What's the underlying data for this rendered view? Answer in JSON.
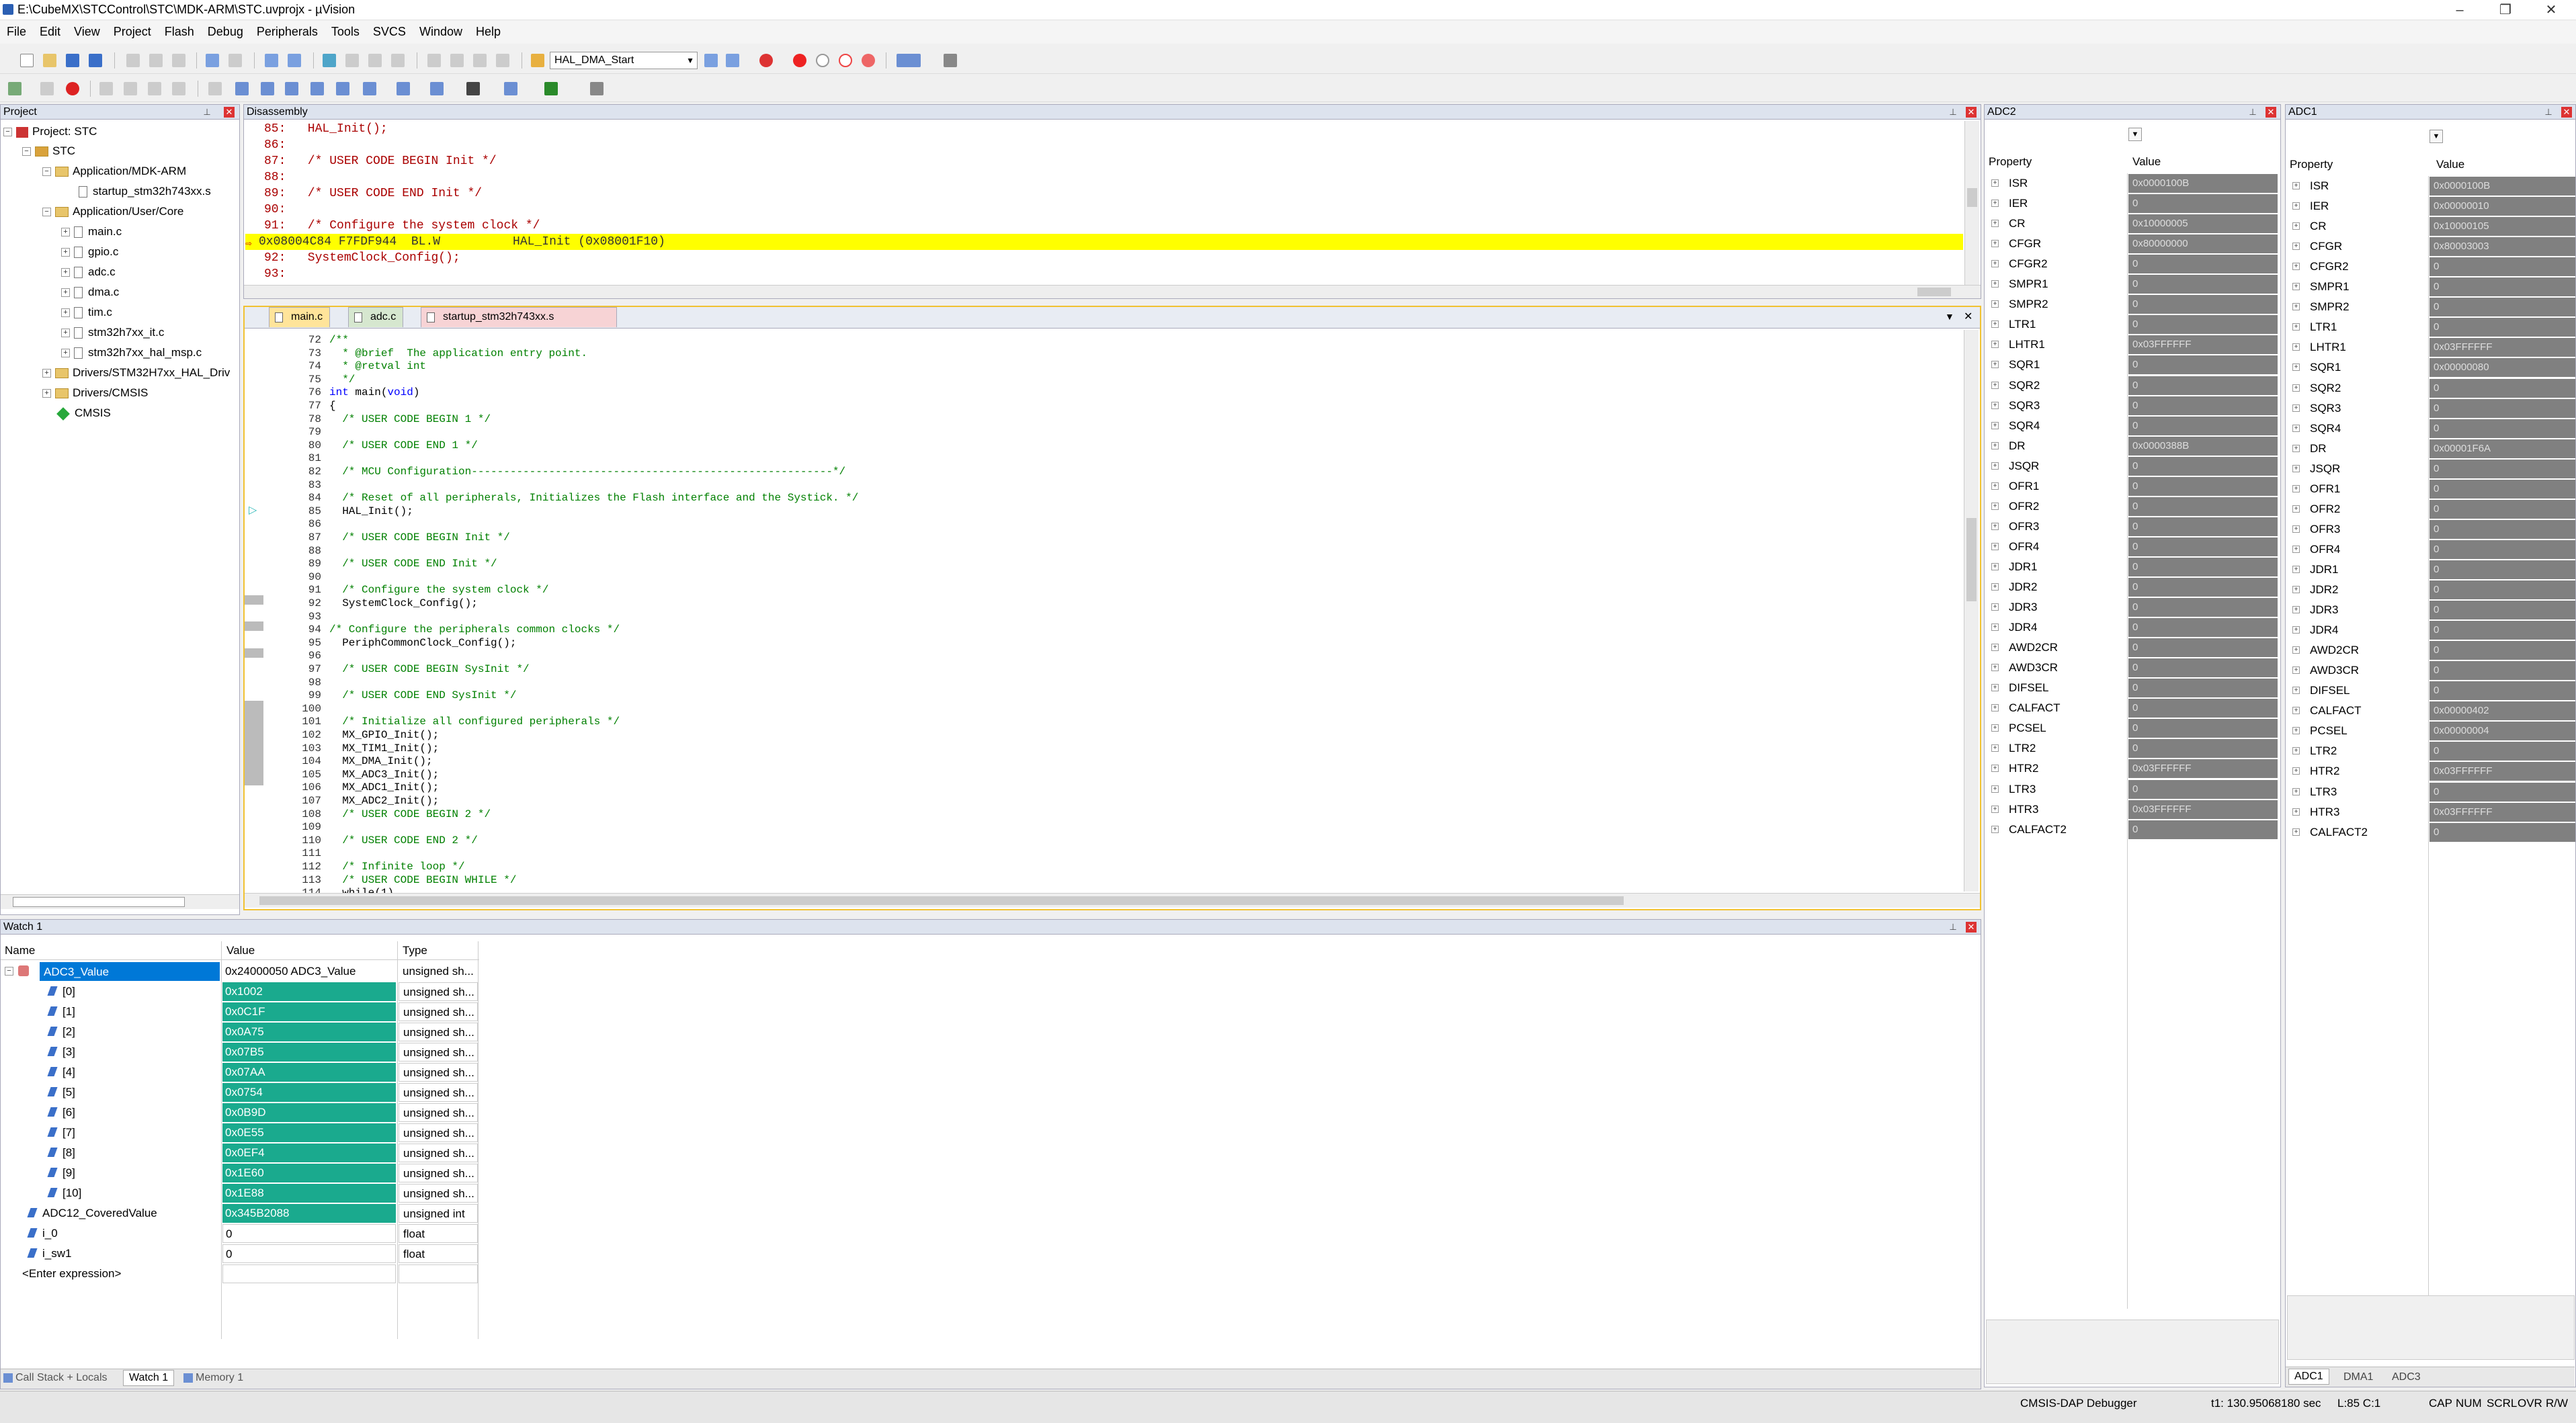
{
  "window": {
    "title": "E:\\CubeMX\\STCControl\\STC\\MDK-ARM\\STC.uvprojx - µVision"
  },
  "menu": [
    "File",
    "Edit",
    "View",
    "Project",
    "Flash",
    "Debug",
    "Peripherals",
    "Tools",
    "SVCS",
    "Window",
    "Help"
  ],
  "toolbar": {
    "target_combo": "HAL_DMA_Start"
  },
  "project": {
    "title": "Project",
    "root": "Project: STC",
    "target": "STC",
    "groups": [
      {
        "name": "Application/MDK-ARM",
        "files": [
          "startup_stm32h743xx.s"
        ]
      },
      {
        "name": "Application/User/Core",
        "files": [
          "main.c",
          "gpio.c",
          "adc.c",
          "dma.c",
          "tim.c",
          "stm32h7xx_it.c",
          "stm32h7xx_hal_msp.c"
        ]
      },
      {
        "name": "Drivers/STM32H7xx_HAL_Driv",
        "files": []
      },
      {
        "name": "Drivers/CMSIS",
        "files": []
      }
    ],
    "cmsis": "CMSIS"
  },
  "disassembly": {
    "title": "Disassembly",
    "lines": [
      "85:   HAL_Init();",
      "86: ",
      "87:   /* USER CODE BEGIN Init */",
      "88: ",
      "89:   /* USER CODE END Init */",
      "90: ",
      "91:   /* Configure the system clock */"
    ],
    "highlight": "0x08004C84 F7FDF944  BL.W          HAL_Init (0x08001F10)",
    "after": [
      "92:   SystemClock_Config();",
      "93: "
    ]
  },
  "editor": {
    "tabs": [
      "main.c",
      "adc.c",
      "startup_stm32h743xx.s"
    ],
    "lines": [
      {
        "n": "72",
        "t": "/**",
        "c": "cm"
      },
      {
        "n": "73",
        "t": "  * @brief  The application entry point.",
        "c": "cm"
      },
      {
        "n": "74",
        "t": "  * @retval int",
        "c": "cm"
      },
      {
        "n": "75",
        "t": "  */",
        "c": "cm"
      },
      {
        "n": "76",
        "t": "int main(void)",
        "c": ""
      },
      {
        "n": "77",
        "t": "{",
        "c": ""
      },
      {
        "n": "78",
        "t": "  /* USER CODE BEGIN 1 */",
        "c": "cm"
      },
      {
        "n": "79",
        "t": "",
        "c": ""
      },
      {
        "n": "80",
        "t": "  /* USER CODE END 1 */",
        "c": "cm"
      },
      {
        "n": "81",
        "t": "",
        "c": ""
      },
      {
        "n": "82",
        "t": "  /* MCU Configuration--------------------------------------------------------*/",
        "c": "cm"
      },
      {
        "n": "83",
        "t": "",
        "c": ""
      },
      {
        "n": "84",
        "t": "  /* Reset of all peripherals, Initializes the Flash interface and the Systick. */",
        "c": "cm"
      },
      {
        "n": "85",
        "t": "  HAL_Init();",
        "c": ""
      },
      {
        "n": "86",
        "t": "",
        "c": ""
      },
      {
        "n": "87",
        "t": "  /* USER CODE BEGIN Init */",
        "c": "cm"
      },
      {
        "n": "88",
        "t": "",
        "c": ""
      },
      {
        "n": "89",
        "t": "  /* USER CODE END Init */",
        "c": "cm"
      },
      {
        "n": "90",
        "t": "",
        "c": ""
      },
      {
        "n": "91",
        "t": "  /* Configure the system clock */",
        "c": "cm"
      },
      {
        "n": "92",
        "t": "  SystemClock_Config();",
        "c": ""
      },
      {
        "n": "93",
        "t": "",
        "c": ""
      },
      {
        "n": "94",
        "t": "/* Configure the peripherals common clocks */",
        "c": "cm"
      },
      {
        "n": "95",
        "t": "  PeriphCommonClock_Config();",
        "c": ""
      },
      {
        "n": "96",
        "t": "",
        "c": ""
      },
      {
        "n": "97",
        "t": "  /* USER CODE BEGIN SysInit */",
        "c": "cm"
      },
      {
        "n": "98",
        "t": "",
        "c": ""
      },
      {
        "n": "99",
        "t": "  /* USER CODE END SysInit */",
        "c": "cm"
      },
      {
        "n": "100",
        "t": "",
        "c": ""
      },
      {
        "n": "101",
        "t": "  /* Initialize all configured peripherals */",
        "c": "cm"
      },
      {
        "n": "102",
        "t": "  MX_GPIO_Init();",
        "c": ""
      },
      {
        "n": "103",
        "t": "  MX_TIM1_Init();",
        "c": ""
      },
      {
        "n": "104",
        "t": "  MX_DMA_Init();",
        "c": ""
      },
      {
        "n": "105",
        "t": "  MX_ADC3_Init();",
        "c": ""
      },
      {
        "n": "106",
        "t": "  MX_ADC1_Init();",
        "c": ""
      },
      {
        "n": "107",
        "t": "  MX_ADC2_Init();",
        "c": ""
      },
      {
        "n": "108",
        "t": "  /* USER CODE BEGIN 2 */",
        "c": "cm"
      },
      {
        "n": "109",
        "t": "",
        "c": ""
      },
      {
        "n": "110",
        "t": "  /* USER CODE END 2 */",
        "c": "cm"
      },
      {
        "n": "111",
        "t": "",
        "c": ""
      },
      {
        "n": "112",
        "t": "  /* Infinite loop */",
        "c": "cm"
      },
      {
        "n": "113",
        "t": "  /* USER CODE BEGIN WHILE */",
        "c": "cm"
      },
      {
        "n": "114",
        "t": "  while(1)",
        "c": ""
      }
    ]
  },
  "adc2": {
    "title": "ADC2",
    "col_property": "Property",
    "col_value": "Value",
    "rows": [
      [
        "ISR",
        "0x0000100B"
      ],
      [
        "IER",
        "0"
      ],
      [
        "CR",
        "0x10000005"
      ],
      [
        "CFGR",
        "0x80000000"
      ],
      [
        "CFGR2",
        "0"
      ],
      [
        "SMPR1",
        "0"
      ],
      [
        "SMPR2",
        "0"
      ],
      [
        "LTR1",
        "0"
      ],
      [
        "LHTR1",
        "0x03FFFFFF"
      ],
      [
        "SQR1",
        "0"
      ],
      [
        "SQR2",
        "0"
      ],
      [
        "SQR3",
        "0"
      ],
      [
        "SQR4",
        "0"
      ],
      [
        "DR",
        "0x0000388B"
      ],
      [
        "JSQR",
        "0"
      ],
      [
        "OFR1",
        "0"
      ],
      [
        "OFR2",
        "0"
      ],
      [
        "OFR3",
        "0"
      ],
      [
        "OFR4",
        "0"
      ],
      [
        "JDR1",
        "0"
      ],
      [
        "JDR2",
        "0"
      ],
      [
        "JDR3",
        "0"
      ],
      [
        "JDR4",
        "0"
      ],
      [
        "AWD2CR",
        "0"
      ],
      [
        "AWD3CR",
        "0"
      ],
      [
        "DIFSEL",
        "0"
      ],
      [
        "CALFACT",
        "0"
      ],
      [
        "PCSEL",
        "0"
      ],
      [
        "LTR2",
        "0"
      ],
      [
        "HTR2",
        "0x03FFFFFF"
      ],
      [
        "LTR3",
        "0"
      ],
      [
        "HTR3",
        "0x03FFFFFF"
      ],
      [
        "CALFACT2",
        "0"
      ]
    ]
  },
  "adc1": {
    "title": "ADC1",
    "col_property": "Property",
    "col_value": "Value",
    "rows": [
      [
        "ISR",
        "0x0000100B"
      ],
      [
        "IER",
        "0x00000010"
      ],
      [
        "CR",
        "0x10000105"
      ],
      [
        "CFGR",
        "0x80003003"
      ],
      [
        "CFGR2",
        "0"
      ],
      [
        "SMPR1",
        "0"
      ],
      [
        "SMPR2",
        "0"
      ],
      [
        "LTR1",
        "0"
      ],
      [
        "LHTR1",
        "0x03FFFFFF"
      ],
      [
        "SQR1",
        "0x00000080"
      ],
      [
        "SQR2",
        "0"
      ],
      [
        "SQR3",
        "0"
      ],
      [
        "SQR4",
        "0"
      ],
      [
        "DR",
        "0x00001F6A"
      ],
      [
        "JSQR",
        "0"
      ],
      [
        "OFR1",
        "0"
      ],
      [
        "OFR2",
        "0"
      ],
      [
        "OFR3",
        "0"
      ],
      [
        "OFR4",
        "0"
      ],
      [
        "JDR1",
        "0"
      ],
      [
        "JDR2",
        "0"
      ],
      [
        "JDR3",
        "0"
      ],
      [
        "JDR4",
        "0"
      ],
      [
        "AWD2CR",
        "0"
      ],
      [
        "AWD3CR",
        "0"
      ],
      [
        "DIFSEL",
        "0"
      ],
      [
        "CALFACT",
        "0x00000402"
      ],
      [
        "PCSEL",
        "0x00000004"
      ],
      [
        "LTR2",
        "0"
      ],
      [
        "HTR2",
        "0x03FFFFFF"
      ],
      [
        "LTR3",
        "0"
      ],
      [
        "HTR3",
        "0x03FFFFFF"
      ],
      [
        "CALFACT2",
        "0"
      ]
    ],
    "bottom_tabs": [
      "ADC1",
      "DMA1",
      "ADC3"
    ]
  },
  "watch": {
    "title": "Watch 1",
    "col_name": "Name",
    "col_value": "Value",
    "col_type": "Type",
    "root": {
      "name": "ADC3_Value",
      "value": "0x24000050 ADC3_Value",
      "type": "unsigned sh..."
    },
    "items": [
      {
        "name": "[0]",
        "value": "0x1002",
        "type": "unsigned sh..."
      },
      {
        "name": "[1]",
        "value": "0x0C1F",
        "type": "unsigned sh..."
      },
      {
        "name": "[2]",
        "value": "0x0A75",
        "type": "unsigned sh..."
      },
      {
        "name": "[3]",
        "value": "0x07B5",
        "type": "unsigned sh..."
      },
      {
        "name": "[4]",
        "value": "0x07AA",
        "type": "unsigned sh..."
      },
      {
        "name": "[5]",
        "value": "0x0754",
        "type": "unsigned sh..."
      },
      {
        "name": "[6]",
        "value": "0x0B9D",
        "type": "unsigned sh..."
      },
      {
        "name": "[7]",
        "value": "0x0E55",
        "type": "unsigned sh..."
      },
      {
        "name": "[8]",
        "value": "0x0EF4",
        "type": "unsigned sh..."
      },
      {
        "name": "[9]",
        "value": "0x1E60",
        "type": "unsigned sh..."
      },
      {
        "name": "[10]",
        "value": "0x1E88",
        "type": "unsigned sh..."
      }
    ],
    "others": [
      {
        "name": "ADC12_CoveredValue",
        "value": "0x345B2088",
        "type": "unsigned int",
        "teal": true
      },
      {
        "name": "i_0",
        "value": "0",
        "type": "float",
        "teal": false
      },
      {
        "name": "i_sw1",
        "value": "0",
        "type": "float",
        "teal": false
      }
    ],
    "enter": "<Enter expression>",
    "bottom_tabs": [
      "Call Stack + Locals",
      "Watch 1",
      "Memory 1"
    ]
  },
  "status": {
    "debugger": "CMSIS-DAP Debugger",
    "time": "t1: 130.95068180 sec",
    "pos": "L:85 C:1",
    "caps": "CAP",
    "num": "NUM",
    "scrl": "SCRL",
    "ovr": "OVR",
    "rw": "R/W"
  }
}
